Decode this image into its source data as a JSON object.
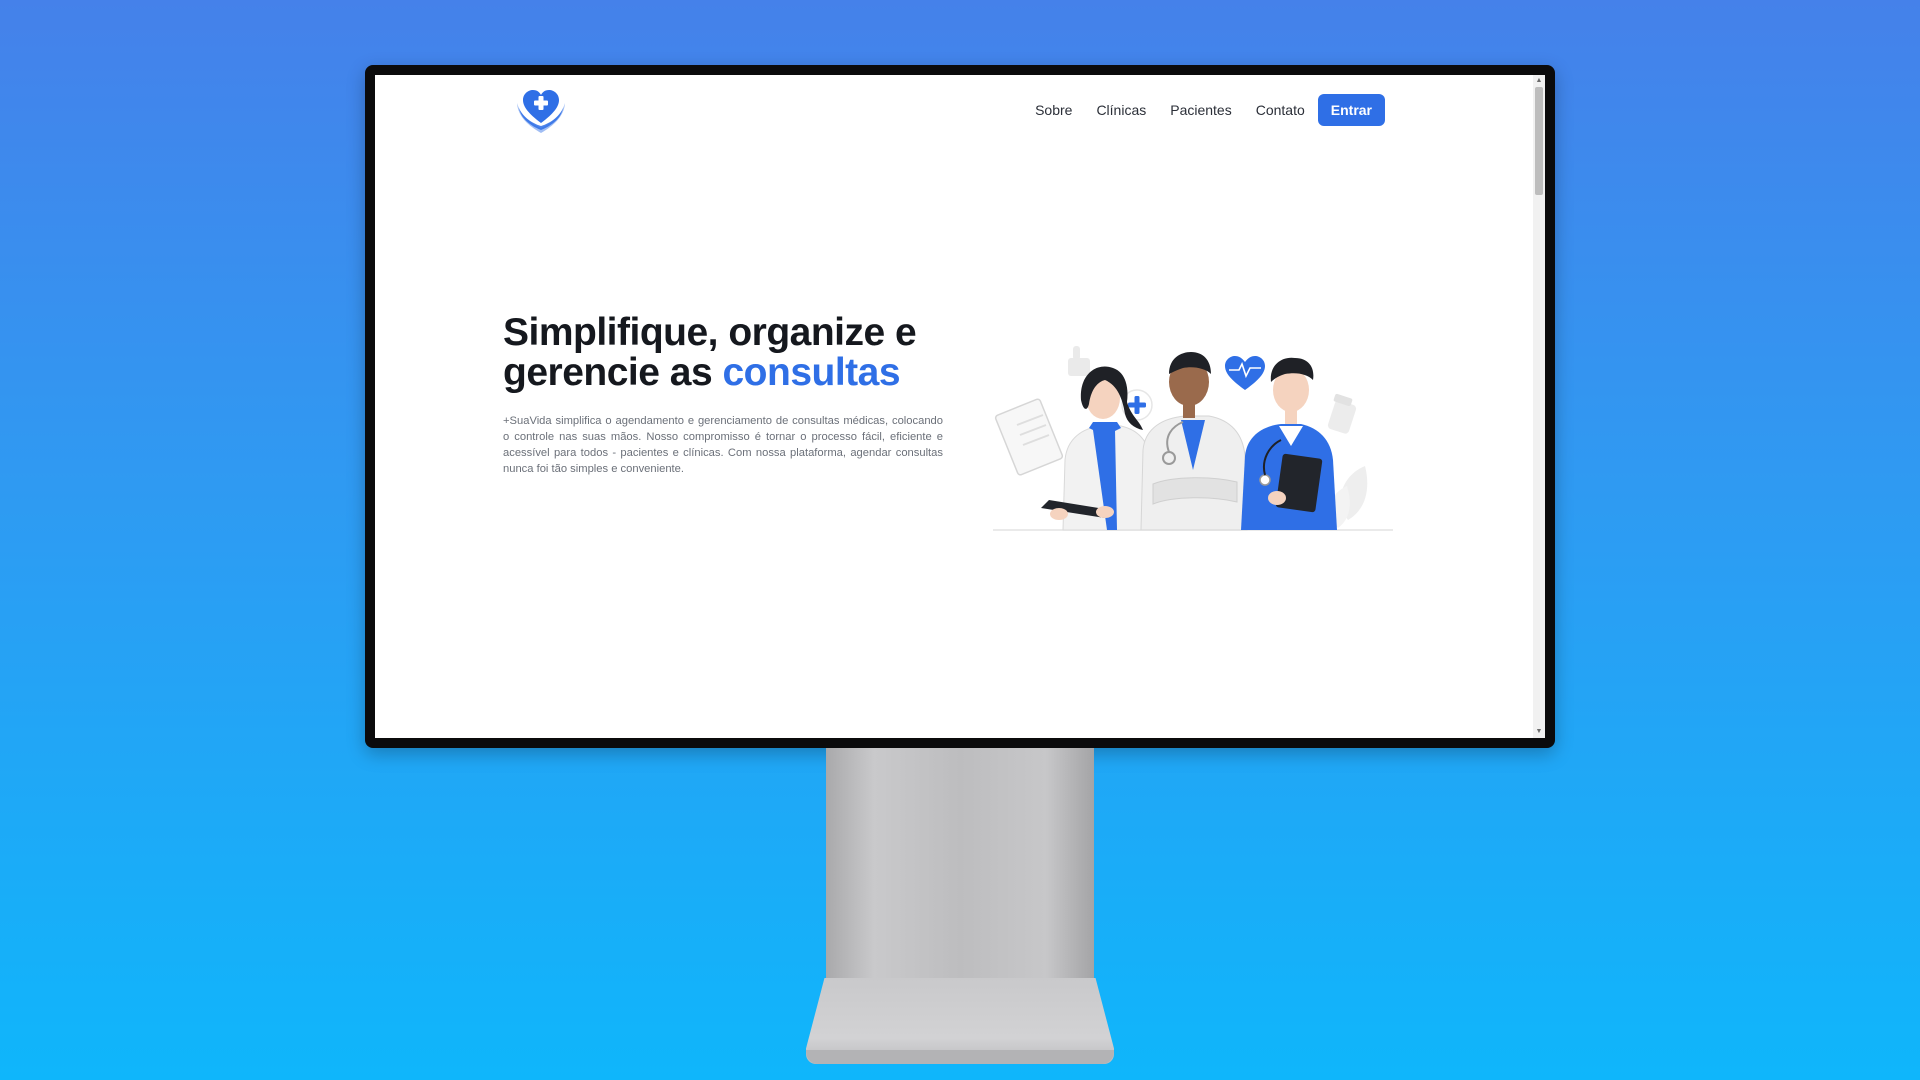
{
  "navbar": {
    "logo_icon": "heart-cross-hands-icon",
    "links": [
      {
        "label": "Sobre"
      },
      {
        "label": "Clínicas"
      },
      {
        "label": "Pacientes"
      },
      {
        "label": "Contato"
      }
    ],
    "login_label": "Entrar"
  },
  "hero": {
    "title_line1": "Simplifique, organize e",
    "title_line2_prefix": "gerencie as",
    "title_accent": "consultas",
    "description": "+SuaVida simplifica o agendamento e gerenciamento de consultas médicas, colocando o controle nas suas mãos. Nosso compromisso é tornar o processo fácil, eficiente e acessível para todos - pacientes e clínicas. Com nossa plataforma, agendar consultas nunca foi tão simples e conveniente."
  },
  "illustration": {
    "icons": [
      "doctors-team-illustration",
      "heart-pulse-icon",
      "plus-cross-icon",
      "thumbs-up-icon",
      "pill-bottle-icon",
      "clipboard-icon"
    ]
  },
  "colors": {
    "accent": "#2f6fe6",
    "title": "#15181e",
    "body_text": "#6b7079",
    "background_top": "#4581ea",
    "background_bottom": "#0fb6fb"
  }
}
